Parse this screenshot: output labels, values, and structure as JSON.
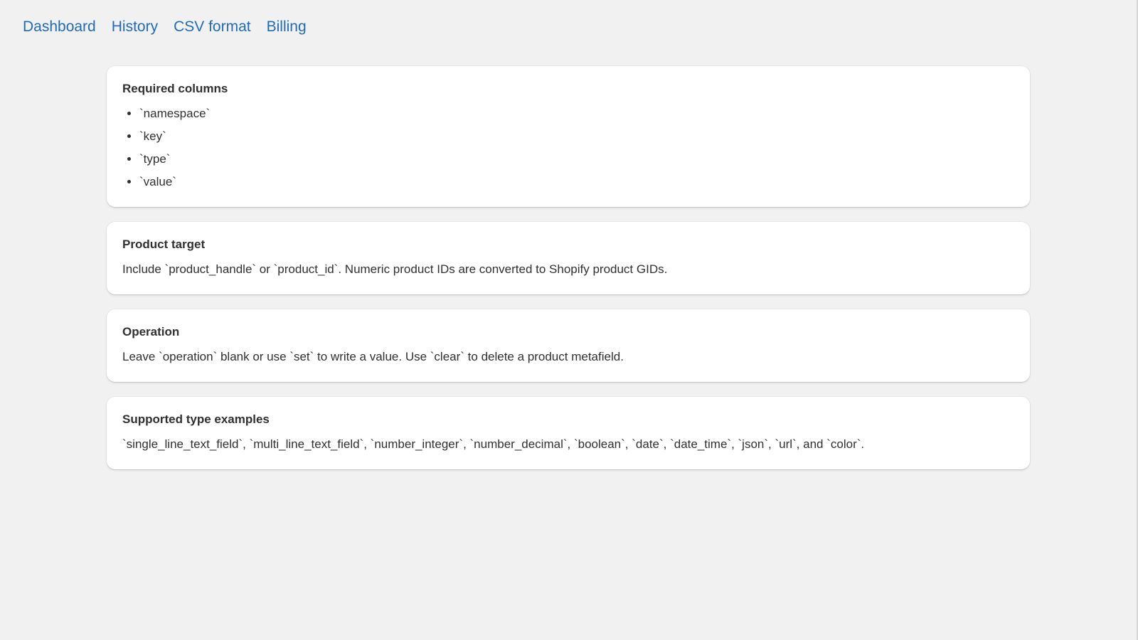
{
  "nav": {
    "items": [
      {
        "label": "Dashboard"
      },
      {
        "label": "History"
      },
      {
        "label": "CSV format"
      },
      {
        "label": "Billing"
      }
    ]
  },
  "cards": {
    "required": {
      "title": "Required columns",
      "items": [
        "`namespace`",
        "`key`",
        "`type`",
        "`value`"
      ]
    },
    "product_target": {
      "title": "Product target",
      "text": "Include `product_handle` or `product_id`. Numeric product IDs are converted to Shopify product GIDs."
    },
    "operation": {
      "title": "Operation",
      "text": "Leave `operation` blank or use `set` to write a value. Use `clear` to delete a product metafield."
    },
    "types": {
      "title": "Supported type examples",
      "text": "`single_line_text_field`, `multi_line_text_field`, `number_integer`, `number_decimal`, `boolean`, `date`, `date_time`, `json`, `url`, and `color`."
    }
  },
  "colors": {
    "link": "#1f6bb8",
    "background": "#f1f1f1",
    "card": "#ffffff"
  }
}
